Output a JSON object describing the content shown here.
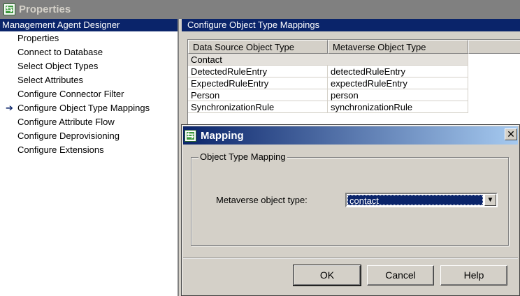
{
  "window": {
    "title": "Properties"
  },
  "left": {
    "header": "Management Agent Designer",
    "items": [
      {
        "label": "Properties",
        "active": false
      },
      {
        "label": "Connect to Database",
        "active": false
      },
      {
        "label": "Select Object Types",
        "active": false
      },
      {
        "label": "Select Attributes",
        "active": false
      },
      {
        "label": "Configure Connector Filter",
        "active": false
      },
      {
        "label": "Configure Object Type Mappings",
        "active": true
      },
      {
        "label": "Configure Attribute Flow",
        "active": false
      },
      {
        "label": "Configure Deprovisioning",
        "active": false
      },
      {
        "label": "Configure Extensions",
        "active": false
      }
    ]
  },
  "right": {
    "header": "Configure Object Type Mappings",
    "columns": [
      "Data Source Object Type",
      "Metaverse Object Type"
    ],
    "group": "Contact",
    "rows": [
      [
        "DetectedRuleEntry",
        "detectedRuleEntry"
      ],
      [
        "ExpectedRuleEntry",
        "expectedRuleEntry"
      ],
      [
        "Person",
        "person"
      ],
      [
        "SynchronizationRule",
        "synchronizationRule"
      ]
    ]
  },
  "dialog": {
    "title": "Mapping",
    "close": "✕",
    "group_label": "Object Type Mapping",
    "field_label": "Metaverse object type:",
    "field_value": "contact",
    "buttons": {
      "ok": "OK",
      "cancel": "Cancel",
      "help": "Help"
    }
  },
  "icons": {
    "app": "app-icon",
    "arrow": "arrow-right-icon",
    "dropdown": "chevron-down-icon"
  },
  "colors": {
    "selection": "#0a246a",
    "face": "#d4d0c8"
  }
}
